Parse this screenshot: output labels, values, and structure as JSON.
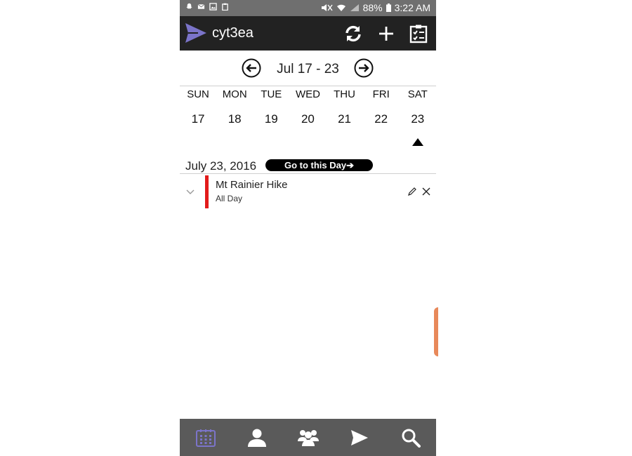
{
  "status_bar": {
    "battery": "88%",
    "time": "3:22 AM"
  },
  "app_bar": {
    "title": "cyt3ea",
    "actions": [
      "refresh-icon",
      "add-icon",
      "checklist-icon"
    ]
  },
  "week_nav": {
    "label": "Jul  17 - 23"
  },
  "days": [
    {
      "name": "SUN",
      "date": "17"
    },
    {
      "name": "MON",
      "date": "18"
    },
    {
      "name": "TUE",
      "date": "19"
    },
    {
      "name": "WED",
      "date": "20"
    },
    {
      "name": "THU",
      "date": "21"
    },
    {
      "name": "FRI",
      "date": "22"
    },
    {
      "name": "SAT",
      "date": "23"
    }
  ],
  "selected_day": "SAT",
  "day_view": {
    "date_label": "July 23, 2016",
    "goto_label": "Go to this Day➔"
  },
  "events": [
    {
      "title": "Mt Rainier Hike",
      "time": "All Day",
      "color": "#e21b1b"
    }
  ],
  "bottom_nav": [
    "calendar-icon",
    "person-icon",
    "group-icon",
    "send-icon",
    "search-icon"
  ],
  "colors": {
    "status_bar": "#6f6f6f",
    "app_bar": "#222222",
    "bottom_bar": "#5a5a5a",
    "accent": "#7b74c9"
  }
}
